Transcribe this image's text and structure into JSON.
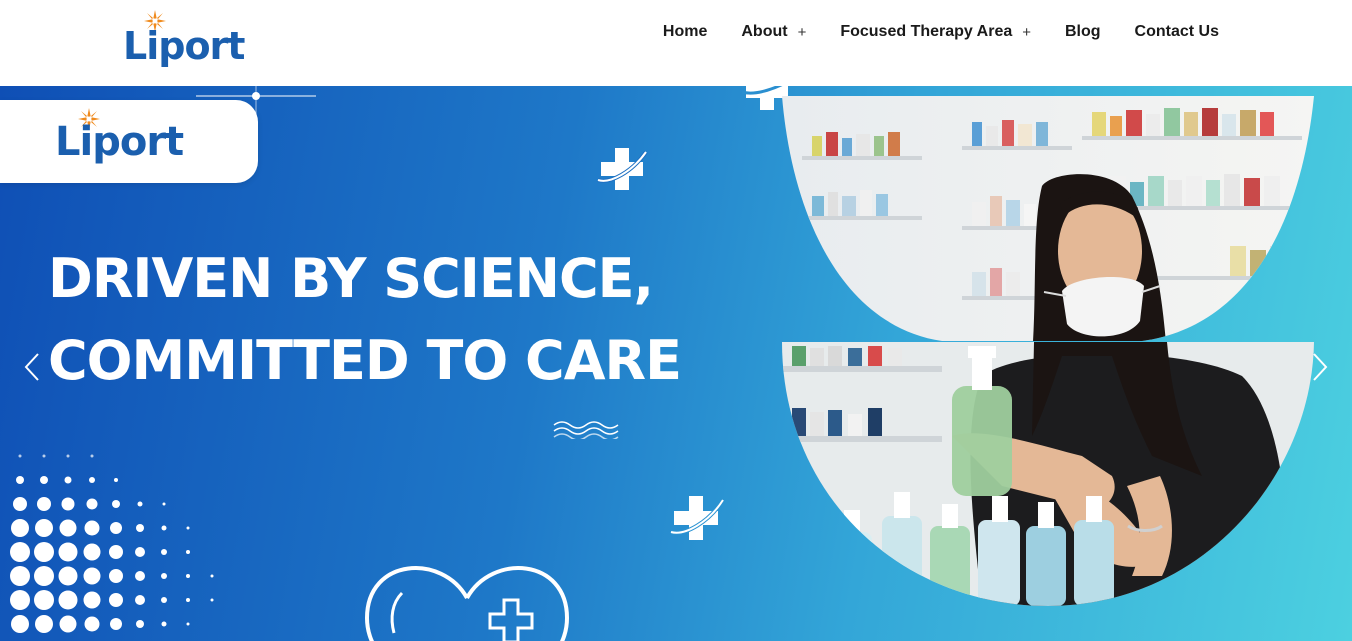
{
  "header": {
    "logo_text": "Liport",
    "nav": [
      {
        "label": "Home",
        "has_submenu": false
      },
      {
        "label": "About",
        "has_submenu": true
      },
      {
        "label": "Focused Therapy Area",
        "has_submenu": true
      },
      {
        "label": "Blog",
        "has_submenu": false
      },
      {
        "label": "Contact Us",
        "has_submenu": false
      }
    ],
    "submenu_glyph": "+"
  },
  "hero": {
    "logo_text": "Liport",
    "headline": [
      "DRIVEN BY SCIENCE,",
      "COMMITTED TO CARE"
    ],
    "prev_icon": "chevron-left-icon",
    "next_icon": "chevron-right-icon",
    "image_alt": "Pharmacist wearing a face mask holding a bottle of hand sanitizer"
  },
  "colors": {
    "brand_blue": "#1b5fae",
    "star_orange": "#f08a1c",
    "gradient_start": "#0f4fb5",
    "gradient_end": "#4cd0e0"
  }
}
